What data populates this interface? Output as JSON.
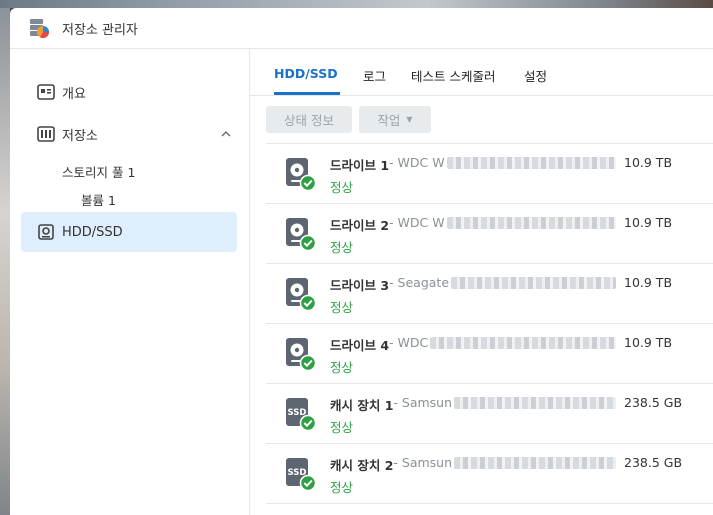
{
  "app": {
    "title": "저장소 관리자"
  },
  "sidebar": {
    "overview": "개요",
    "storage": "저장소",
    "storage_pool": "스토리지 풀 1",
    "volume": "볼륨 1",
    "hdd_ssd": "HDD/SSD"
  },
  "tabs": [
    "HDD/SSD",
    "로그",
    "테스트 스케줄러",
    "설정"
  ],
  "toolbar": {
    "status_info": "상태 정보",
    "action": "작업"
  },
  "drives": [
    {
      "name": "드라이브 1",
      "model": " - WDC W",
      "status": "정상",
      "size": "10.9 TB",
      "type": "hdd"
    },
    {
      "name": "드라이브 2",
      "model": " - WDC W",
      "status": "정상",
      "size": "10.9 TB",
      "type": "hdd"
    },
    {
      "name": "드라이브 3",
      "model": " - Seagate",
      "status": "정상",
      "size": "10.9 TB",
      "type": "hdd"
    },
    {
      "name": "드라이브 4",
      "model": " - WDC",
      "status": "정상",
      "size": "10.9 TB",
      "type": "hdd"
    },
    {
      "name": "캐시 장치 1",
      "model": " - Samsun",
      "status": "정상",
      "size": "238.5 GB",
      "type": "ssd"
    },
    {
      "name": "캐시 장치 2",
      "model": " - Samsun",
      "status": "정상",
      "size": "238.5 GB",
      "type": "ssd"
    }
  ],
  "icons": {
    "ssd_label": "SSD",
    "status_color": "#2ea043",
    "accent_color": "#1a73c7"
  }
}
